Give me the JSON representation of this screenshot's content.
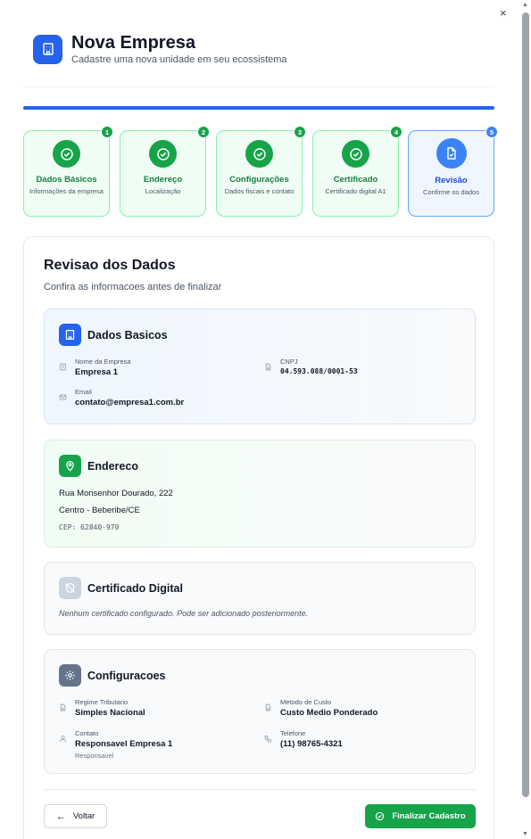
{
  "dialog": {
    "close_label": "×"
  },
  "header": {
    "title": "Nova Empresa",
    "subtitle": "Cadastre uma nova unidade em seu ecossistema",
    "icon": "building-icon",
    "accent_color": "#2563eb"
  },
  "progress": {
    "value": 1.0
  },
  "steps": [
    {
      "number": "1",
      "title": "Dados Básicos",
      "description": "Informações da empresa",
      "status": "completed"
    },
    {
      "number": "2",
      "title": "Endereço",
      "description": "Localização",
      "status": "completed"
    },
    {
      "number": "3",
      "title": "Configurações",
      "description": "Dados fiscais e contato",
      "status": "completed"
    },
    {
      "number": "4",
      "title": "Certificado",
      "description": "Certificado digital A1",
      "status": "completed"
    },
    {
      "number": "5",
      "title": "Revisão",
      "description": "Confirme os dados",
      "status": "active"
    }
  ],
  "review": {
    "title": "Revisao dos Dados",
    "subtitle": "Confira as informacoes antes de finalizar"
  },
  "dados_basicos": {
    "title": "Dados Basicos",
    "nome_label": "Nome da Empresa",
    "nome_value": "Empresa 1",
    "cnpj_label": "CNPJ",
    "cnpj_value": "04.593.088/0001-53",
    "email_label": "Email",
    "email_value": "contato@empresa1.com.br"
  },
  "endereco": {
    "title": "Endereco",
    "street": "Rua Monsenhor Dourado, 222",
    "city": "Centro - Beberibe/CE",
    "cep": "CEP: 62840-970"
  },
  "certificado": {
    "title": "Certificado Digital",
    "message": "Nenhum certificado configurado. Pode ser adicionado posteriormente."
  },
  "configuracoes": {
    "title": "Configuracoes",
    "regime_label": "Regime Tributario",
    "regime_value": "Simples Nacional",
    "metodo_label": "Metodo de Custo",
    "metodo_value": "Custo Medio Ponderado",
    "contato_label": "Contato",
    "contato_value": "Responsavel Empresa 1",
    "contato_note": "Responsavel",
    "telefone_label": "Telefone",
    "telefone_value": "(11) 98765-4321"
  },
  "footer": {
    "back_label": "Voltar",
    "finish_label": "Finalizar Cadastro"
  },
  "colors": {
    "primary": "#2563eb",
    "success": "#16a34a",
    "completed_bg": "#f0fdf4",
    "active_bg": "#eff6ff"
  }
}
